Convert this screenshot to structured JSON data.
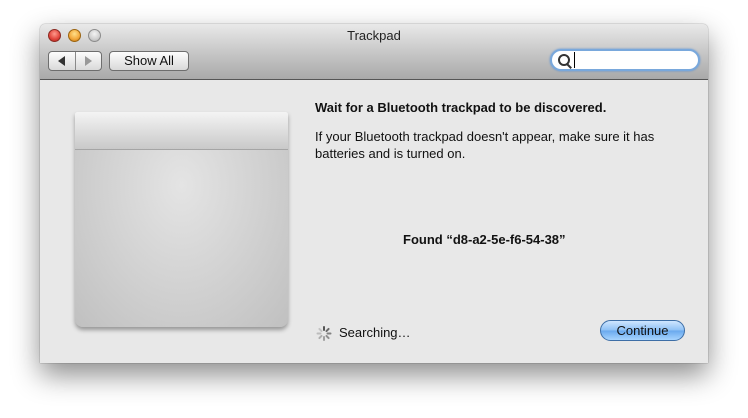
{
  "window": {
    "title": "Trackpad"
  },
  "toolbar": {
    "show_all_label": "Show All",
    "search": {
      "value": "",
      "placeholder": ""
    }
  },
  "dialog": {
    "heading": "Wait for a Bluetooth trackpad to be discovered.",
    "body": "If your Bluetooth trackpad doesn't appear, make sure it has batteries and is turned on.",
    "found": "Found “d8-a2-5e-f6-54-38”",
    "status": "Searching…",
    "continue_label": "Continue"
  },
  "colors": {
    "accent": "#6aa9ee",
    "focus_ring": "#79a8dc"
  },
  "icons": [
    "close-icon",
    "minimize-icon",
    "zoom-icon",
    "back-arrow-icon",
    "forward-arrow-icon",
    "search-icon",
    "spinner-icon",
    "trackpad-image"
  ]
}
